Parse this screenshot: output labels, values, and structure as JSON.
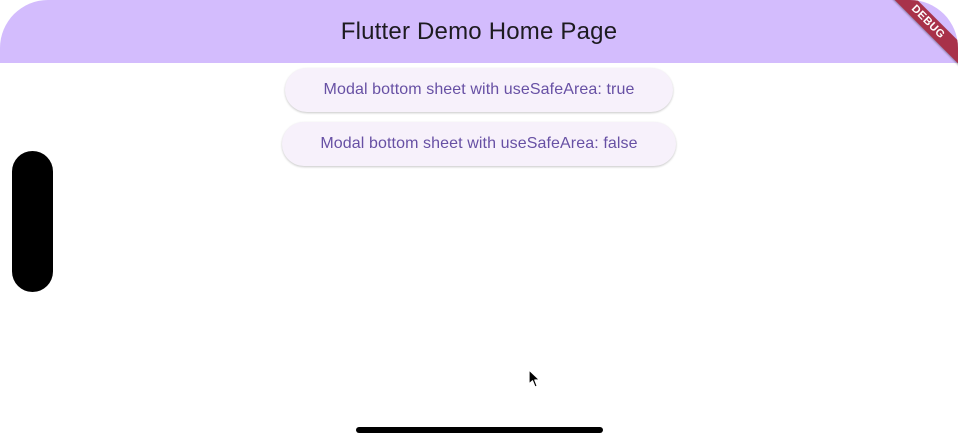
{
  "app_bar": {
    "title": "Flutter Demo Home Page",
    "background": "#d3bcfd"
  },
  "debug_banner": {
    "label": "DEBUG",
    "color": "#a8324a"
  },
  "buttons": [
    {
      "label": "Modal bottom sheet with useSafeArea: true"
    },
    {
      "label": "Modal bottom sheet with useSafeArea: false"
    }
  ],
  "colors": {
    "button_background": "#f7f1fb",
    "button_text": "#6750a4",
    "title_text": "#1d1b20"
  },
  "icons": {
    "cursor": "mouse-pointer-icon"
  }
}
